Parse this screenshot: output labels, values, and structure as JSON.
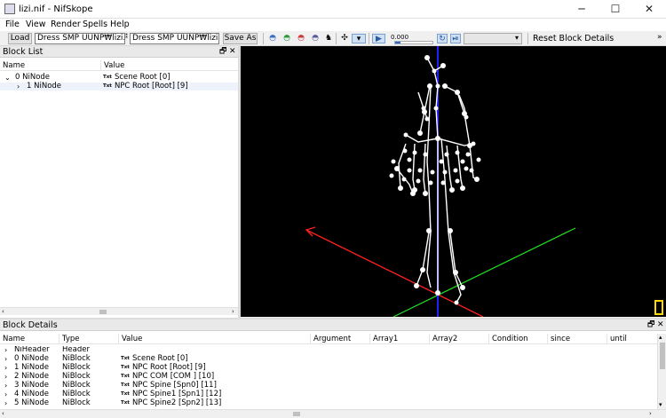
{
  "window": {
    "title": "lizi.nif - NifSkope",
    "minimize": "─",
    "maximize": "☐",
    "close": "✕"
  },
  "menu": [
    "File",
    "View",
    "Render",
    "Spells",
    "Help"
  ],
  "toolbar": {
    "load": "Load",
    "load_path": "Dress SMP UUNP₩lizi.nif",
    "save_path": "Dress SMP UUNP₩lizi.nif",
    "save_as": "Save As",
    "anim_time": "0.000",
    "reset": "Reset Block Details",
    "overflow": "»"
  },
  "block_list": {
    "title": "Block List",
    "columns": [
      "Name",
      "Value"
    ],
    "rows": [
      {
        "name": "0 NiNode",
        "value": "Scene Root [0]",
        "indent": 0,
        "arrow": "⌄"
      },
      {
        "name": "1 NiNode",
        "value": "NPC Root [Root] [9]",
        "indent": 1,
        "arrow": "›"
      }
    ]
  },
  "block_details": {
    "title": "Block Details",
    "columns": [
      "Name",
      "Type",
      "Value",
      "Argument",
      "Array1",
      "Array2",
      "Condition",
      "since",
      "until"
    ],
    "rows": [
      {
        "name": "NiHeader",
        "type": "Header",
        "value": "",
        "txt": false
      },
      {
        "name": "0 NiNode",
        "type": "NiBlock",
        "value": "Scene Root [0]",
        "txt": true
      },
      {
        "name": "1 NiNode",
        "type": "NiBlock",
        "value": "NPC Root [Root] [9]",
        "txt": true
      },
      {
        "name": "2 NiNode",
        "type": "NiBlock",
        "value": "NPC COM [COM ] [10]",
        "txt": true
      },
      {
        "name": "3 NiNode",
        "type": "NiBlock",
        "value": "NPC Spine [Spn0] [11]",
        "txt": true
      },
      {
        "name": "4 NiNode",
        "type": "NiBlock",
        "value": "NPC Spine1 [Spn1] [12]",
        "txt": true
      },
      {
        "name": "5 NiNode",
        "type": "NiBlock",
        "value": "NPC Spine2 [Spn2] [13]",
        "txt": true
      }
    ]
  },
  "icons": {
    "txt_badge": "Txt",
    "dock_float": "🗗",
    "dock_close": "✕"
  },
  "colors": {
    "viewport_bg": "#000000",
    "axis_x": "#ff2020",
    "axis_y": "#20e020",
    "axis_z": "#2020ff",
    "skeleton": "#ffffff",
    "highlight": "#ffd800"
  }
}
